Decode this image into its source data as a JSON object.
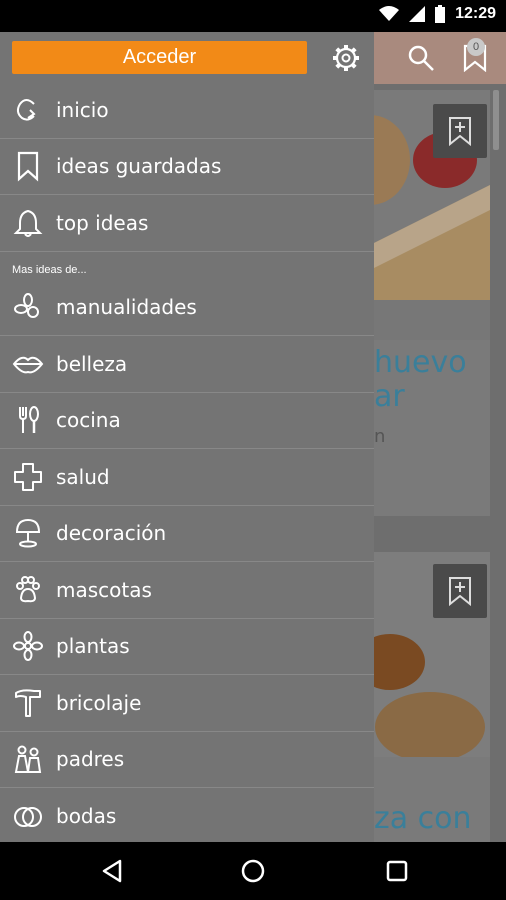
{
  "status_bar": {
    "time": "12:29"
  },
  "toolbar": {
    "badge_count": "0"
  },
  "drawer": {
    "login_label": "Acceder",
    "section_label": "Mas ideas de...",
    "items_top": [
      {
        "label": "inicio",
        "icon": "home-swirl-icon"
      },
      {
        "label": "ideas guardadas",
        "icon": "bookmark-icon"
      },
      {
        "label": "top ideas",
        "icon": "bell-icon"
      }
    ],
    "items_more": [
      {
        "label": "manualidades",
        "icon": "crafts-icon"
      },
      {
        "label": "belleza",
        "icon": "lips-icon"
      },
      {
        "label": "cocina",
        "icon": "cutlery-icon"
      },
      {
        "label": "salud",
        "icon": "health-cross-icon"
      },
      {
        "label": "decoración",
        "icon": "lamp-icon"
      },
      {
        "label": "mascotas",
        "icon": "paw-icon"
      },
      {
        "label": "plantas",
        "icon": "flower-icon"
      },
      {
        "label": "bricolaje",
        "icon": "hammer-icon"
      },
      {
        "label": "padres",
        "icon": "parents-icon"
      },
      {
        "label": "bodas",
        "icon": "rings-icon"
      }
    ]
  },
  "cards": [
    {
      "title_line1": "huevo",
      "title_line2": "ar",
      "subtitle": "n"
    },
    {
      "title_line1": "za con"
    }
  ],
  "colors": {
    "accent": "#f28a17",
    "drawer_bg": "#747474",
    "title_blue": "#3a7f9a"
  }
}
